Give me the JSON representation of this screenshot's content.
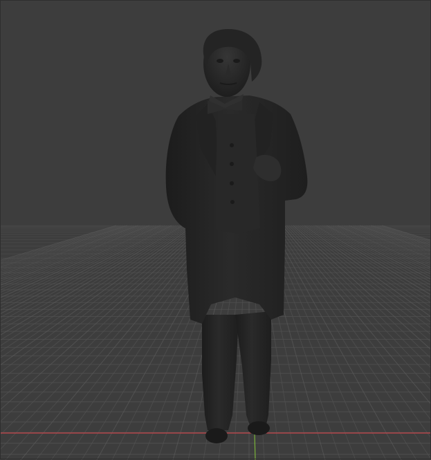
{
  "viewport": {
    "background_color": "#3d3d3d",
    "grid_color": "#525252",
    "grid_major_color": "#5a5a5a",
    "x_axis_color": "#c8464b",
    "y_axis_color": "#7ab33a",
    "model_color": "#262626",
    "model_shade_color": "#1c1c1c",
    "model_highlight_color": "#343434",
    "grid_visible": true,
    "model": "statue-figure"
  }
}
